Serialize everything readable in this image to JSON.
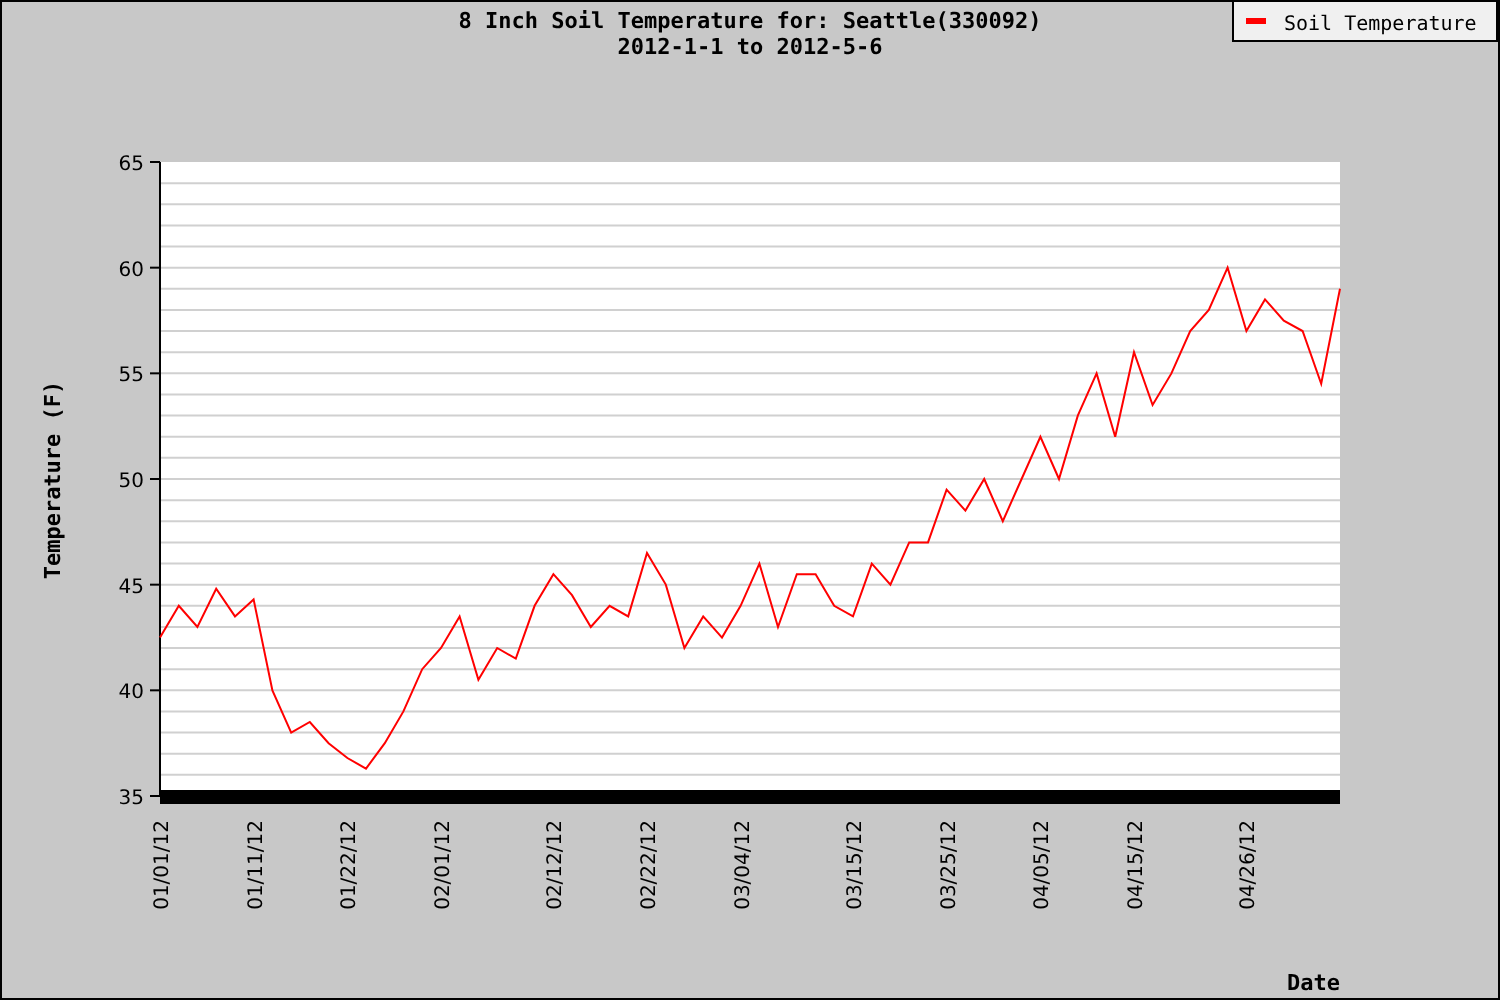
{
  "chart": {
    "chart_data": {
      "type": "line",
      "title": "8 Inch Soil Temperature for: Seattle(330092)\n2012-1-1 to 2012-5-6",
      "xlabel": "Date",
      "ylabel": "Temperature (F)",
      "categories": [
        "01/01/12",
        null,
        null,
        null,
        null,
        "01/11/12",
        null,
        null,
        null,
        null,
        "01/22/12",
        null,
        null,
        null,
        null,
        "02/01/12",
        null,
        null,
        null,
        null,
        null,
        "02/12/12",
        null,
        null,
        null,
        null,
        "02/22/12",
        null,
        null,
        null,
        null,
        "03/04/12",
        null,
        null,
        null,
        null,
        null,
        "03/15/12",
        null,
        null,
        null,
        null,
        "03/25/12",
        null,
        null,
        null,
        null,
        "04/05/12",
        null,
        null,
        null,
        null,
        "04/15/12",
        null,
        null,
        null,
        null,
        null,
        "04/26/12",
        null,
        null,
        null,
        null,
        null
      ],
      "series": [
        {
          "name": "Soil Temperature",
          "color": "#ff0000",
          "values": [
            42.5,
            44,
            43,
            44.8,
            43.5,
            44.3,
            40,
            38,
            38.5,
            37.5,
            36.8,
            36.3,
            37.5,
            39,
            41,
            42,
            43.5,
            40.5,
            42,
            41.5,
            44,
            45.5,
            44.5,
            43,
            44,
            43.5,
            46.5,
            45,
            42,
            43.5,
            42.5,
            44,
            46,
            43,
            45.5,
            45.5,
            44,
            43.5,
            46,
            45,
            47,
            47,
            49.5,
            48.5,
            50,
            48,
            50,
            52,
            50,
            53,
            55,
            52,
            56,
            53.5,
            55,
            57,
            58,
            60,
            57,
            58.5,
            57.5,
            57,
            54.5,
            59
          ]
        }
      ],
      "ylim": [
        35,
        65
      ],
      "grid": true,
      "yticks": [
        35,
        40,
        45,
        50,
        55,
        60,
        65
      ]
    }
  }
}
